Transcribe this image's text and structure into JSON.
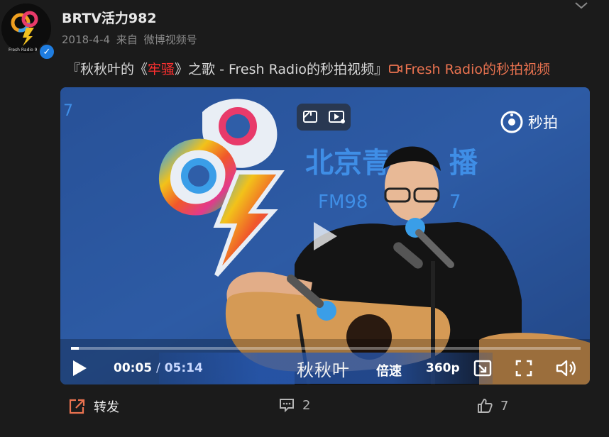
{
  "header": {
    "username": "BRTV活力982",
    "date": "2018-4-4",
    "source_prefix": "来自",
    "source": "微博视频号",
    "avatar_caption": "Fresh Radio 9",
    "verified_mark": "✓"
  },
  "post": {
    "text_before": "『秋秋叶的《",
    "text_highlight": "牢骚",
    "text_after": "》之歌 - Fresh Radio的秒拍视频』",
    "link_label": "Fresh Radio的秒拍视频"
  },
  "video": {
    "current_time": "00:05",
    "time_separator": "/",
    "duration": "05:14",
    "progress": 0.016,
    "speed_label": "倍速",
    "quality_label": "360p",
    "miaopai_label": "秒拍",
    "scene": {
      "station_text": "北京青",
      "station_text_end": "播",
      "freq_text": "FM98",
      "freq_text_end": "7",
      "left_edge_text": "7",
      "subtitle": "秋秋叶"
    }
  },
  "footer": {
    "repost_label": "转发",
    "comment_count": "2",
    "like_count": "7"
  },
  "colors": {
    "accent": "#eb7350",
    "highlight": "#ff3030",
    "verified": "#1f7de0",
    "background": "#1b1b1b"
  },
  "icons": [
    "chevron-down-icon",
    "video-link-icon",
    "pip-icon",
    "picture-in-picture-icon",
    "play-icon",
    "miaopai-logo-icon",
    "repost-icon",
    "comment-icon",
    "like-icon",
    "fullscreen-icon",
    "web-fullscreen-icon",
    "volume-icon"
  ]
}
